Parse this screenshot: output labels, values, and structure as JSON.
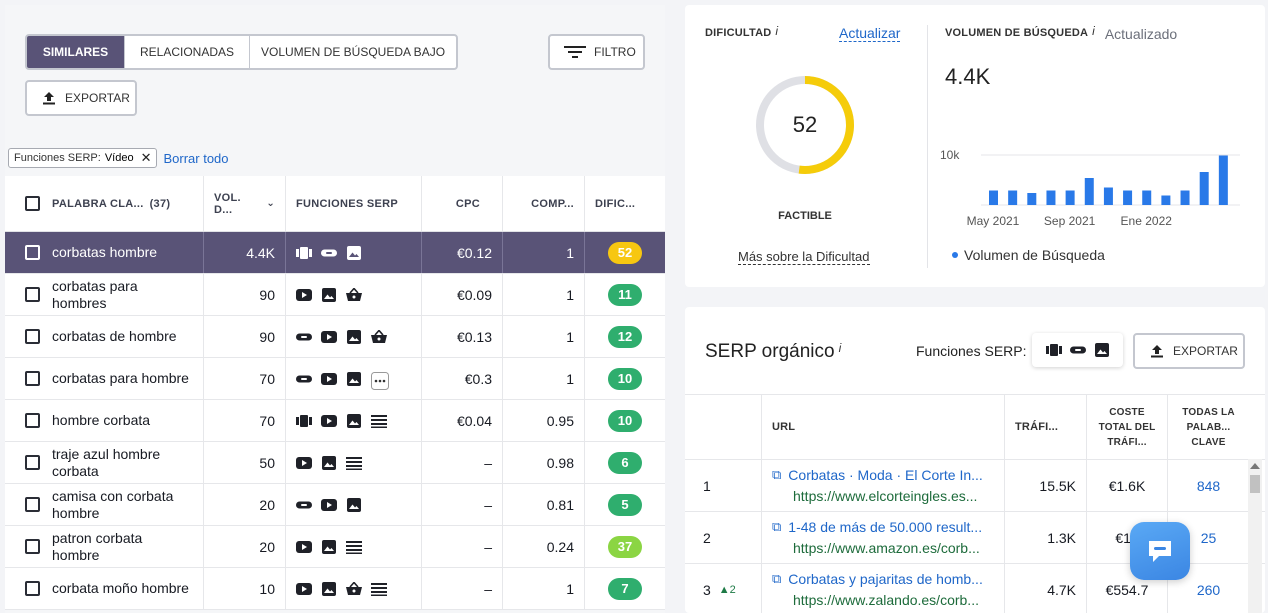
{
  "left": {
    "tabs": [
      "SIMILARES",
      "RELACIONADAS",
      "VOLUMEN DE BÚSQUEDA BAJO"
    ],
    "filter_label": "FILTRO",
    "export_label": "EXPORTAR",
    "active_filter": {
      "name": "Funciones SERP:",
      "value": "Vídeo"
    },
    "clear_all": "Borrar todo",
    "table": {
      "headers": {
        "keyword": "PALABRA CLA...",
        "count": "(37)",
        "volume": "VOL. D...",
        "serp": "FUNCIONES SERP",
        "cpc": "CPC",
        "comp": "COMP...",
        "diff": "DIFIC..."
      },
      "rows": [
        {
          "keyword": "corbatas hombre",
          "volume": "4.4K",
          "serp": [
            "carousel-icon",
            "link-icon",
            "image-icon"
          ],
          "cpc": "€0.12",
          "comp": "1",
          "diff": "52",
          "diff_color": "#f7c711",
          "selected": true
        },
        {
          "keyword": "corbatas para hombres",
          "volume": "90",
          "serp": [
            "video-icon",
            "image-icon",
            "basket-icon"
          ],
          "cpc": "€0.09",
          "comp": "1",
          "diff": "11",
          "diff_color": "#2fae6e"
        },
        {
          "keyword": "corbatas de hombre",
          "volume": "90",
          "serp": [
            "link-icon",
            "video-icon",
            "image-icon",
            "basket-icon"
          ],
          "cpc": "€0.13",
          "comp": "1",
          "diff": "12",
          "diff_color": "#2fae6e"
        },
        {
          "keyword": "corbatas para hombre",
          "volume": "70",
          "serp": [
            "link-icon",
            "video-icon",
            "image-icon",
            "more-icon"
          ],
          "cpc": "€0.3",
          "comp": "1",
          "diff": "10",
          "diff_color": "#2fae6e"
        },
        {
          "keyword": "hombre corbata",
          "volume": "70",
          "serp": [
            "carousel-icon",
            "video-icon",
            "image-icon",
            "list-icon"
          ],
          "cpc": "€0.04",
          "comp": "0.95",
          "diff": "10",
          "diff_color": "#2fae6e"
        },
        {
          "keyword": "traje azul hombre corbata",
          "volume": "50",
          "serp": [
            "video-icon",
            "image-icon",
            "list-icon"
          ],
          "cpc": "–",
          "comp": "0.98",
          "diff": "6",
          "diff_color": "#2fae6e"
        },
        {
          "keyword": "camisa con corbata hombre",
          "volume": "20",
          "serp": [
            "link-icon",
            "video-icon",
            "image-icon"
          ],
          "cpc": "–",
          "comp": "0.81",
          "diff": "5",
          "diff_color": "#2fae6e"
        },
        {
          "keyword": "patron corbata hombre",
          "volume": "20",
          "serp": [
            "video-icon",
            "image-icon",
            "list-icon"
          ],
          "cpc": "–",
          "comp": "0.24",
          "diff": "37",
          "diff_color": "#8bd543"
        },
        {
          "keyword": "corbata moño hombre",
          "volume": "10",
          "serp": [
            "video-icon",
            "image-icon",
            "basket-icon",
            "list-icon"
          ],
          "cpc": "–",
          "comp": "1",
          "diff": "7",
          "diff_color": "#2fae6e"
        }
      ]
    }
  },
  "difficulty": {
    "label": "DIFICULTAD",
    "info": "i",
    "update_link": "Actualizar",
    "value": "52",
    "value_fraction": 0.52,
    "ring_color": "#f5cc0a",
    "level": "FACTIBLE",
    "more_link": "Más sobre la Dificultad"
  },
  "volume": {
    "label": "VOLUMEN DE BÚSQUEDA",
    "info": "i",
    "status": "Actualizado",
    "value": "4.4K",
    "legend": "Volumen de Búsqueda"
  },
  "chart_data": {
    "type": "bar",
    "x_tick_labels": [
      "May 2021",
      "Sep 2021",
      "Ene 2022"
    ],
    "y_tick_labels": [
      "10k"
    ],
    "values": [
      2900,
      2900,
      2400,
      2900,
      2900,
      5400,
      3500,
      2900,
      2900,
      1900,
      2900,
      6600,
      9900
    ],
    "ylim": [
      0,
      15000
    ],
    "series": [
      {
        "name": "Volumen de Búsqueda",
        "color": "#2979e8",
        "values": [
          2900,
          2900,
          2400,
          2900,
          2900,
          5400,
          3500,
          2900,
          2900,
          1900,
          2900,
          6600,
          9900
        ]
      }
    ]
  },
  "serp": {
    "title": "SERP orgánico",
    "info": "i",
    "features_label": "Funciones SERP:",
    "features_icons": [
      "carousel-icon",
      "link-icon",
      "image-icon"
    ],
    "export_label": "EXPORTAR",
    "headers": {
      "url": "URL",
      "traffic": "TRÁFI...",
      "cost": "COSTE TOTAL DEL TRÁFI...",
      "keywords": "TODAS LA PALAB... CLAVE"
    },
    "rows": [
      {
        "pos": "1",
        "delta": "",
        "title": "Corbatas · Moda · El Corte In...",
        "url": "https://www.elcorteingles.es...",
        "traffic": "15.5K",
        "cost": "€1.6K",
        "keywords": "848"
      },
      {
        "pos": "2",
        "delta": "",
        "title": "1-48 de más de 50.000 result...",
        "url": "https://www.amazon.es/corb...",
        "traffic": "1.3K",
        "cost": "€15",
        "keywords": "25"
      },
      {
        "pos": "3",
        "delta": "▲2",
        "title": "Corbatas y pajaritas de homb...",
        "url": "https://www.zalando.es/corb...",
        "traffic": "4.7K",
        "cost": "€554.7",
        "keywords": "260"
      }
    ]
  }
}
